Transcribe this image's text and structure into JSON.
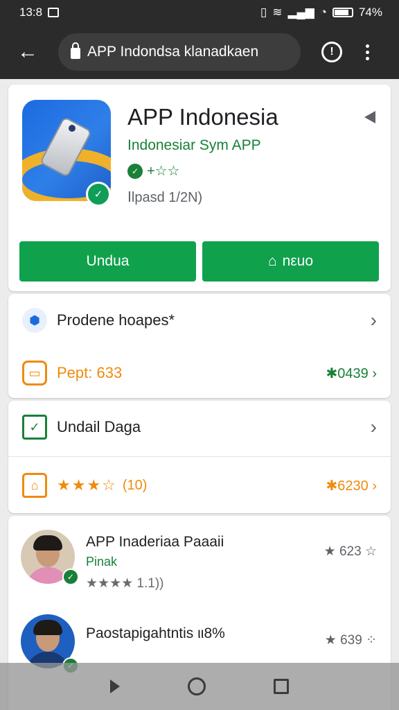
{
  "status": {
    "time": "13:8",
    "battery": "74%"
  },
  "toolbar": {
    "url": "APP Indondsa klanadkaen"
  },
  "app": {
    "title": "APP Indonesia",
    "subtitle": "Indonesiar Sym APP",
    "rating_stars": "+☆☆",
    "meta": "Ⅰlpasd 1/2N)",
    "install_label": "Undua",
    "open_label": "nεuo"
  },
  "details": {
    "row1_label": "Prodene hoapes*",
    "row2_label": "Pept: 633",
    "row2_value": "✱0439 ›"
  },
  "rating": {
    "row1_label": "Undail Daga",
    "stars": "★★★☆",
    "count": "(10)",
    "value": "✱6230 ›"
  },
  "reviews": [
    {
      "name": "APP Inaderiaa Paaaii",
      "sub": "Pinak",
      "stars": "★★★★ 1.1))",
      "score": "★ 623 ☆"
    },
    {
      "name": "Paostapigahtntis ιι8%",
      "sub": "",
      "stars": "",
      "score": "★ 639 ⁘"
    }
  ],
  "colors": {
    "accent_green": "#10a14c",
    "orange": "#ef8a0c",
    "blue_icon": "#1b6be0"
  }
}
